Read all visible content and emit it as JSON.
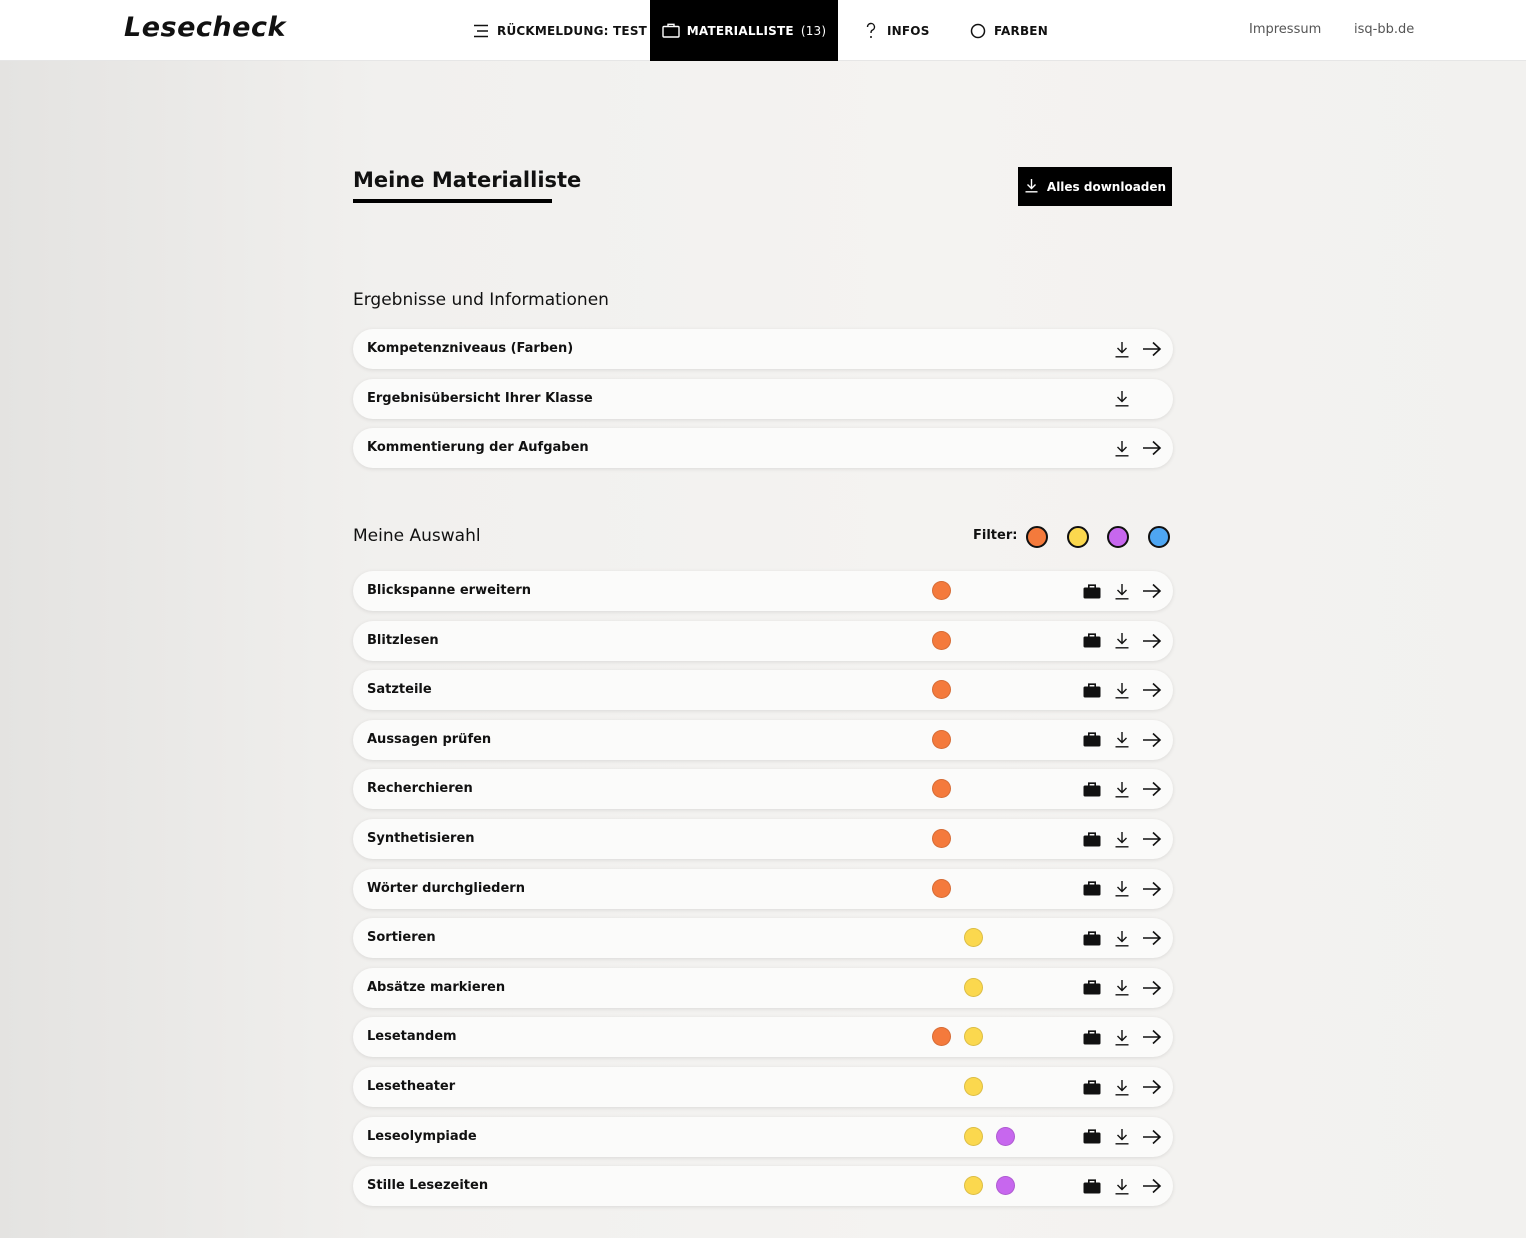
{
  "header": {
    "logo": "Lesecheck",
    "nav": [
      {
        "label": "RÜCKMELDUNG: TEST",
        "icon": "menu-lines-icon"
      },
      {
        "label": "MATERIALLISTE",
        "count": "(13)",
        "icon": "briefcase-icon"
      },
      {
        "label": "INFOS",
        "icon": "question-icon"
      },
      {
        "label": "FARBEN",
        "icon": "circle-icon"
      }
    ],
    "links": [
      "Impressum",
      "isq-bb.de"
    ]
  },
  "page": {
    "title": "Meine Materialliste",
    "download_all": "Alles downloaden"
  },
  "results": {
    "title": "Ergebnisse und Informationen",
    "items": [
      {
        "label": "Kompetenzniveaus (Farben)",
        "download": true,
        "open": true
      },
      {
        "label": "Ergebnisübersicht Ihrer Klasse",
        "download": true,
        "open": false
      },
      {
        "label": "Kommentierung der Aufgaben",
        "download": true,
        "open": true
      }
    ]
  },
  "selection": {
    "title": "Meine Auswahl",
    "filter_label": "Filter:",
    "filter_colors": [
      "#f47a3c",
      "#fbd84e",
      "#c767ee",
      "#4ea6f2"
    ],
    "colors": {
      "orange": "#f47a3c",
      "yellow": "#fbd84e",
      "purple": "#c767ee",
      "blue": "#4ea6f2"
    },
    "items": [
      {
        "label": "Blickspanne erweitern",
        "tags": [
          "orange"
        ]
      },
      {
        "label": "Blitzlesen",
        "tags": [
          "orange"
        ]
      },
      {
        "label": "Satzteile",
        "tags": [
          "orange"
        ]
      },
      {
        "label": "Aussagen prüfen",
        "tags": [
          "orange"
        ]
      },
      {
        "label": "Recherchieren",
        "tags": [
          "orange"
        ]
      },
      {
        "label": "Synthetisieren",
        "tags": [
          "orange"
        ]
      },
      {
        "label": "Wörter durchgliedern",
        "tags": [
          "orange"
        ]
      },
      {
        "label": "Sortieren",
        "tags": [
          "yellow"
        ]
      },
      {
        "label": "Absätze markieren",
        "tags": [
          "yellow"
        ]
      },
      {
        "label": "Lesetandem",
        "tags": [
          "orange",
          "yellow"
        ]
      },
      {
        "label": "Lesetheater",
        "tags": [
          "yellow"
        ]
      },
      {
        "label": "Leseolympiade",
        "tags": [
          "yellow",
          "purple"
        ]
      },
      {
        "label": "Stille Lesezeiten",
        "tags": [
          "yellow",
          "purple"
        ]
      }
    ]
  }
}
